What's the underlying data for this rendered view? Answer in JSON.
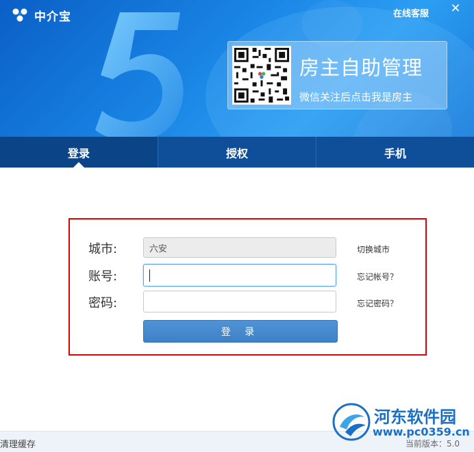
{
  "app": {
    "logo_text": "中介宝",
    "online_service": "在线客服",
    "close_glyph": "✕"
  },
  "promo": {
    "title": "房主自助管理",
    "subtitle": "微信关注后点击我是房主"
  },
  "tabs": [
    {
      "label": "登录",
      "active": true
    },
    {
      "label": "授权",
      "active": false
    },
    {
      "label": "手机",
      "active": false
    }
  ],
  "form": {
    "city_label": "城市:",
    "city_value": "六安",
    "switch_city": "切换城市",
    "account_label": "账号:",
    "account_value": "",
    "forgot_account": "忘记帐号？",
    "password_label": "密码:",
    "password_value": "",
    "forgot_password": "忘记密码？",
    "login_button": "登 录"
  },
  "footer": {
    "clear_cache": "清理缓存",
    "version": "当前版本：5.0"
  },
  "watermark": {
    "name": "河东软件园",
    "url": "www.pc0359.cn"
  },
  "colors": {
    "header_blue": "#1a86e6",
    "tabbar": "#0f4f99",
    "button": "#4686cd",
    "highlight_border": "#e00000"
  }
}
